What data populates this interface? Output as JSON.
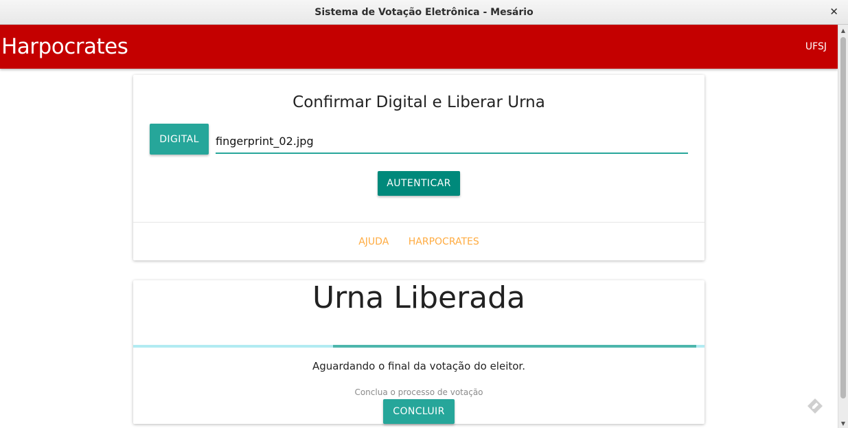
{
  "window": {
    "title": "Sistema de Votação Eletrônica - Mesário",
    "close_glyph": "✕"
  },
  "navbar": {
    "brand": "Harpocrates",
    "link": "UFSJ",
    "color": "#c40000"
  },
  "auth_card": {
    "title": "Confirmar Digital e Liberar Urna",
    "digital_button": "DIGITAL",
    "file_value": "fingerprint_02.jpg",
    "authenticate_button": "AUTENTICAR",
    "actions": [
      "AJUDA",
      "HARPOCRATES"
    ]
  },
  "status_card": {
    "title": "Urna Liberada",
    "progress": {
      "start": 0.35,
      "end": 0.985
    },
    "message": "Aguardando o final da votação do eleitor.",
    "hint": "Conclua o processo de votação",
    "conclude_button": "CONCLUIR"
  },
  "colors": {
    "teal": "#26a69a",
    "dark_teal": "#00897b",
    "orange_link": "#ffab40",
    "progress_track": "#b2ebf2",
    "progress_bar": "#4db6ac"
  },
  "icons": {
    "floating": "pencil-icon"
  }
}
